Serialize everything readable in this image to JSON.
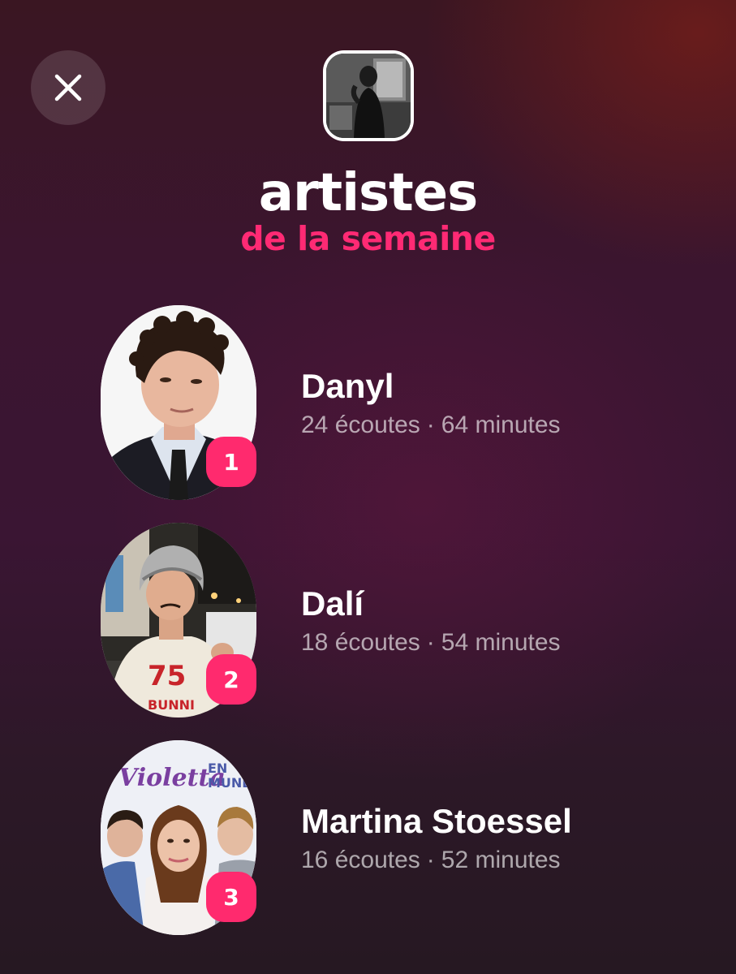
{
  "header": {
    "close_icon": "close-icon",
    "profile_thumbnail": "profile-photo"
  },
  "title": "artistes",
  "subtitle": "de la semaine",
  "colors": {
    "accent": "#ff2a74",
    "badge": "#ff2a6e",
    "text": "#ffffff"
  },
  "artists": [
    {
      "rank": "1",
      "name": "Danyl",
      "plays": "24 écoutes",
      "separator": "·",
      "minutes": "64 minutes"
    },
    {
      "rank": "2",
      "name": "Dalí",
      "plays": "18 écoutes",
      "separator": "·",
      "minutes": "54 minutes"
    },
    {
      "rank": "3",
      "name": "Martina Stoessel",
      "plays": "16 écoutes",
      "separator": "·",
      "minutes": "52 minutes"
    }
  ]
}
